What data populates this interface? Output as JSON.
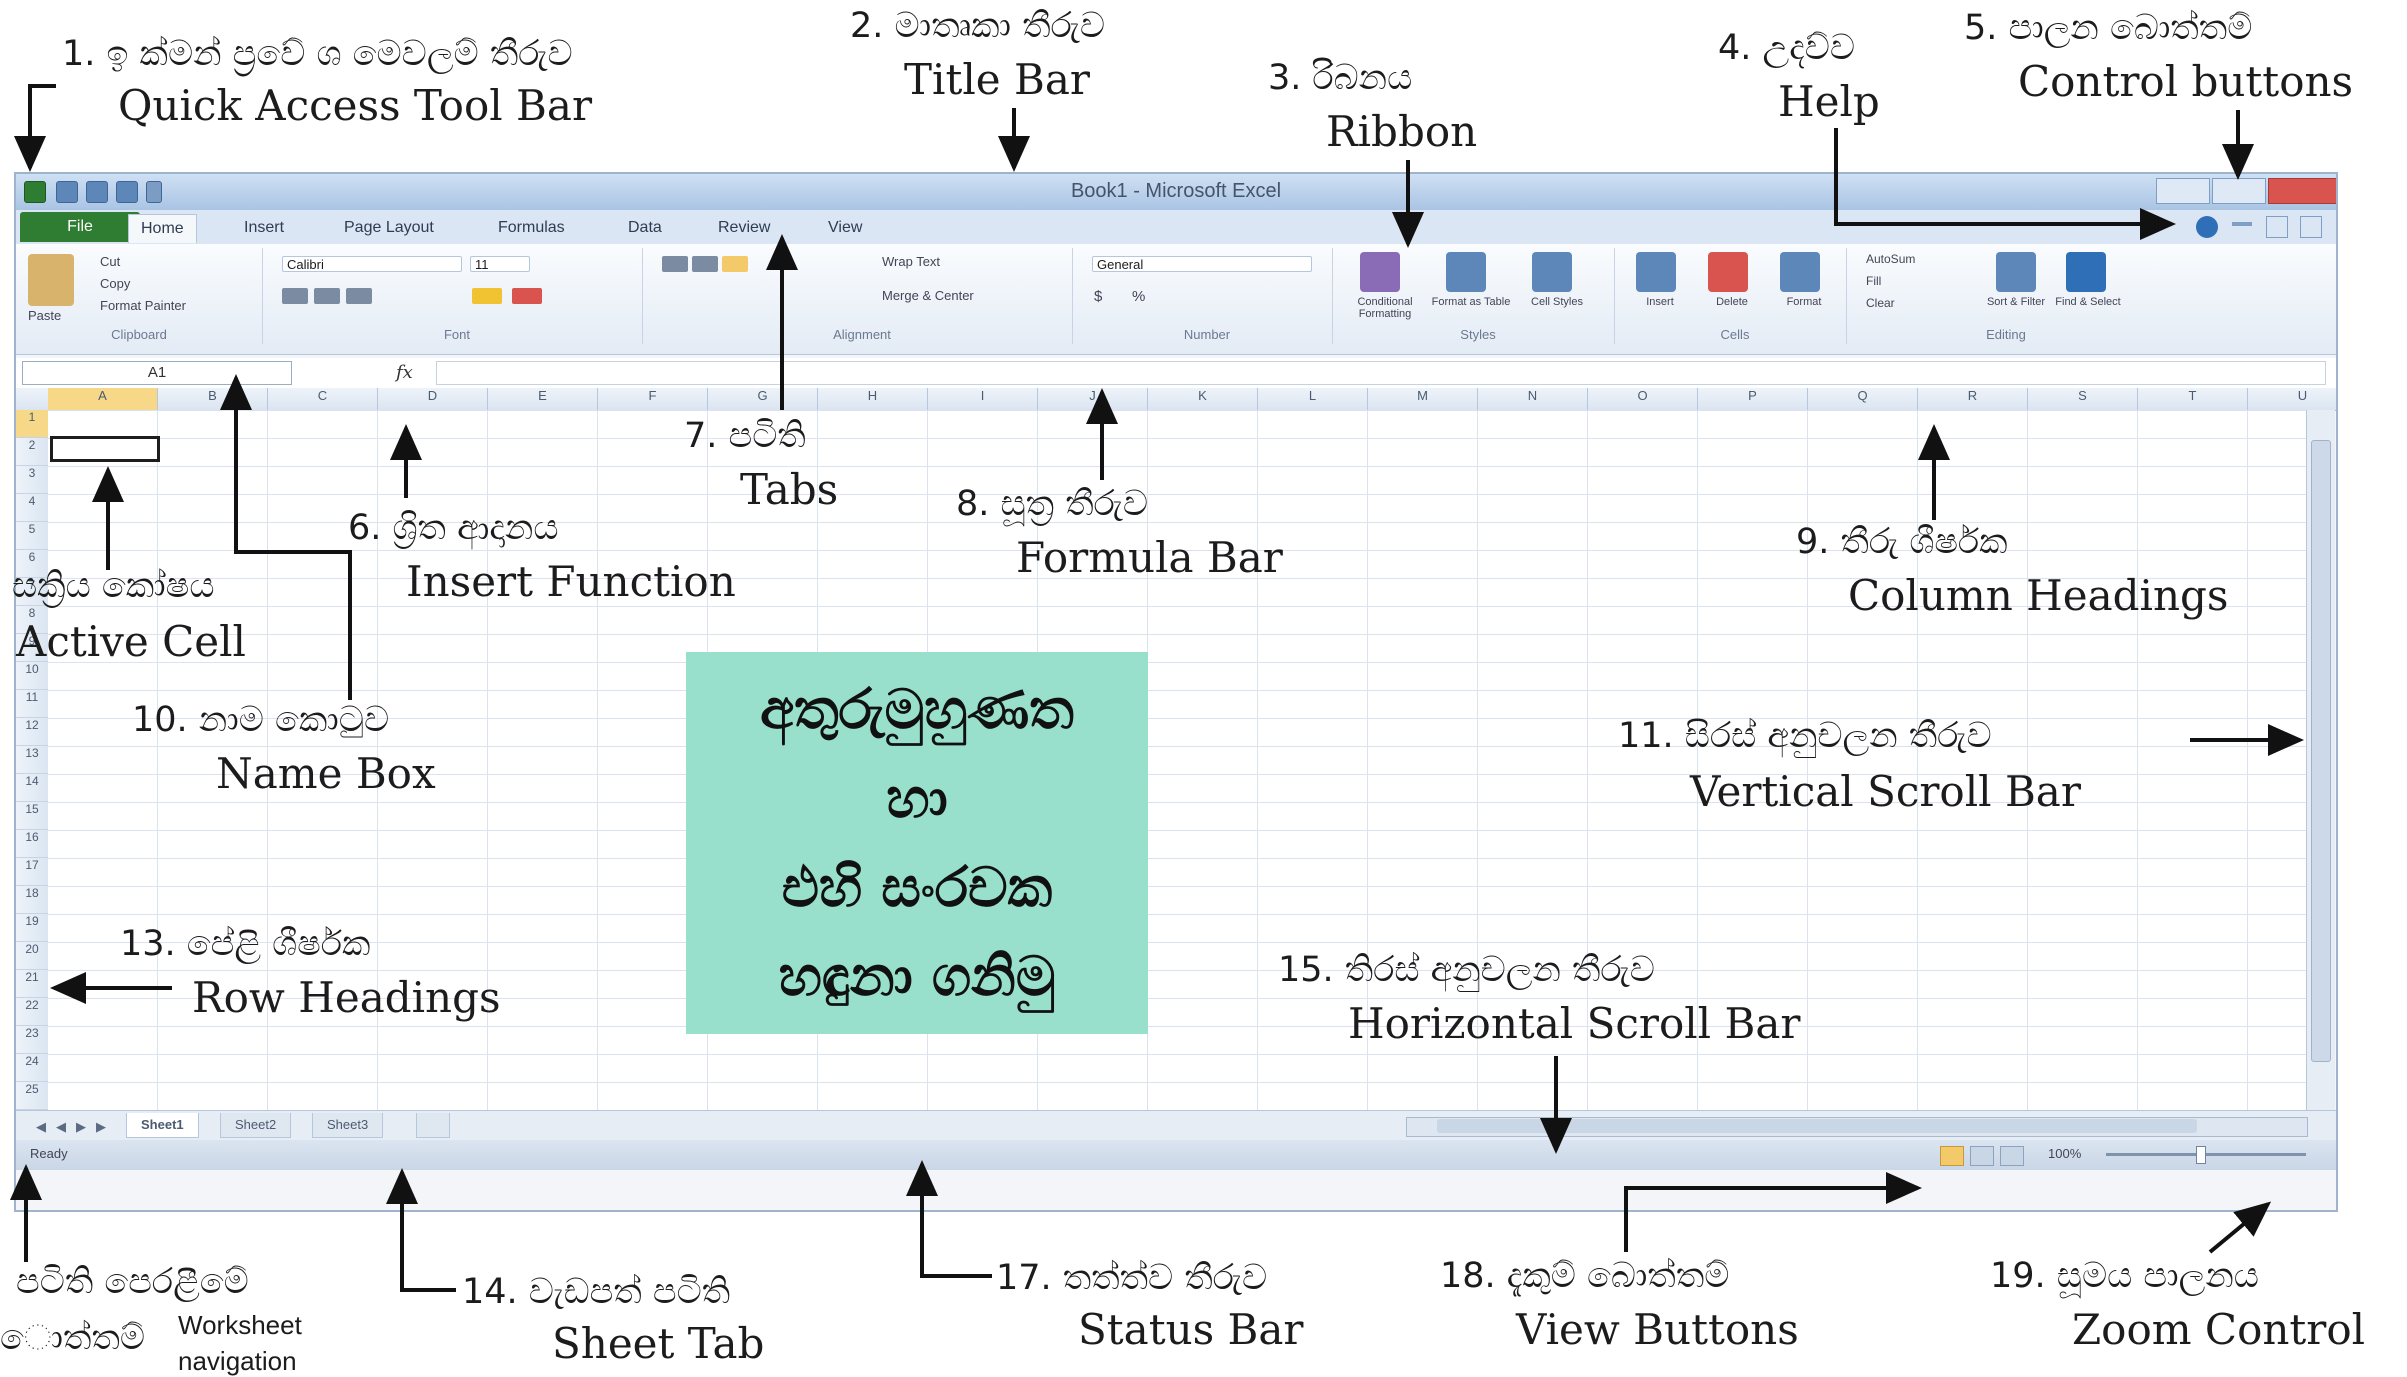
{
  "excel": {
    "window_title": "Book1 - Microsoft Excel",
    "tabs": [
      "File",
      "Home",
      "Insert",
      "Page Layout",
      "Formulas",
      "Data",
      "Review",
      "View"
    ],
    "ribbon_groups": [
      "Clipboard",
      "Font",
      "Alignment",
      "Number",
      "Styles",
      "Cells",
      "Editing"
    ],
    "ribbon_commands": {
      "paste": "Paste",
      "cut": "Cut",
      "copy": "Copy",
      "format_painter": "Format Painter",
      "font_name": "Calibri",
      "font_size": "11",
      "wrap_text": "Wrap Text",
      "merge_center": "Merge & Center",
      "number_format": "General",
      "conditional_formatting": "Conditional Formatting",
      "format_as_table": "Format as Table",
      "cell_styles": "Cell Styles",
      "insert": "Insert",
      "delete": "Delete",
      "format": "Format",
      "autosum": "AutoSum",
      "fill": "Fill",
      "clear": "Clear",
      "sort_filter": "Sort & Filter",
      "find_select": "Find & Select"
    },
    "name_box": "A1",
    "fx": "fx",
    "columns": [
      "A",
      "B",
      "C",
      "D",
      "E",
      "F",
      "G",
      "H",
      "I",
      "J",
      "K",
      "L",
      "M",
      "N",
      "O",
      "P",
      "Q",
      "R",
      "S",
      "T",
      "U"
    ],
    "rows": [
      "1",
      "2",
      "3",
      "4",
      "5",
      "6",
      "7",
      "8",
      "9",
      "10",
      "11",
      "12",
      "13",
      "14",
      "15",
      "16",
      "17",
      "18",
      "19",
      "20",
      "21",
      "22",
      "23",
      "24",
      "25"
    ],
    "sheets": [
      "Sheet1",
      "Sheet2",
      "Sheet3"
    ],
    "status": "Ready",
    "zoom": "100%"
  },
  "labels": {
    "quick_access": {
      "si": "1. ඉ ක්මන් ප්‍රවේ ශ මෙවලම් තීරුව",
      "en": "Quick Access Tool Bar"
    },
    "title_bar": {
      "si": "2. මාතෘකා තීරුව",
      "en": "Title Bar"
    },
    "ribbon": {
      "si": "3. රිබනය",
      "en": "Ribbon"
    },
    "help": {
      "si": "4. උදව්ව",
      "en": "Help"
    },
    "control_buttons": {
      "si": "5. පාලන බොත්තම්",
      "en": "Control buttons"
    },
    "insert_function": {
      "si": "6. ශ්‍රිත ආදානය",
      "en": "Insert Function"
    },
    "tabs": {
      "si": "7. පටිති",
      "en": "Tabs"
    },
    "formula_bar": {
      "si": "8. සූත්‍ර තීරුව",
      "en": "Formula Bar"
    },
    "column_headings": {
      "si": "9. තීරු ශීර්ෂක",
      "en": "Column Headings"
    },
    "active_cell": {
      "si": "සක්‍රිය කෝෂය",
      "en": "Active Cell"
    },
    "name_box": {
      "si": "10. නාම කොටුව",
      "en": "Name Box"
    },
    "vertical_scroll": {
      "si": "11. සිරස් අනුචලන තීරුව",
      "en": "Vertical Scroll Bar"
    },
    "row_headings": {
      "si": "13. පේළි ශීර්ෂක",
      "en": "Row Headings"
    },
    "horizontal_scroll": {
      "si": "15. තිරස් අනුචලන තීරුව",
      "en": "Horizontal Scroll Bar"
    },
    "nav_buttons": {
      "si1": "පටිති පෙරළීමේ",
      "si2": "ොත්තම්",
      "en1": "Worksheet",
      "en2": "navigation"
    },
    "sheet_tab": {
      "si": "14. වැඩපත් පටිති",
      "en": "Sheet Tab"
    },
    "status_bar": {
      "si": "17. තත්ත්ව තීරුව",
      "en": "Status Bar"
    },
    "view_buttons": {
      "si": "18. දැකුම් බොත්තම්",
      "en": "View Buttons"
    },
    "zoom_control": {
      "si": "19. සූමය පාලනය",
      "en": "Zoom Control"
    }
  },
  "center_box": {
    "lines": [
      "අතුරුමුහුණත",
      "හා",
      "එහි සංරචක",
      "හඳුනා ගනිමු"
    ],
    "color": "#98e0cb"
  }
}
